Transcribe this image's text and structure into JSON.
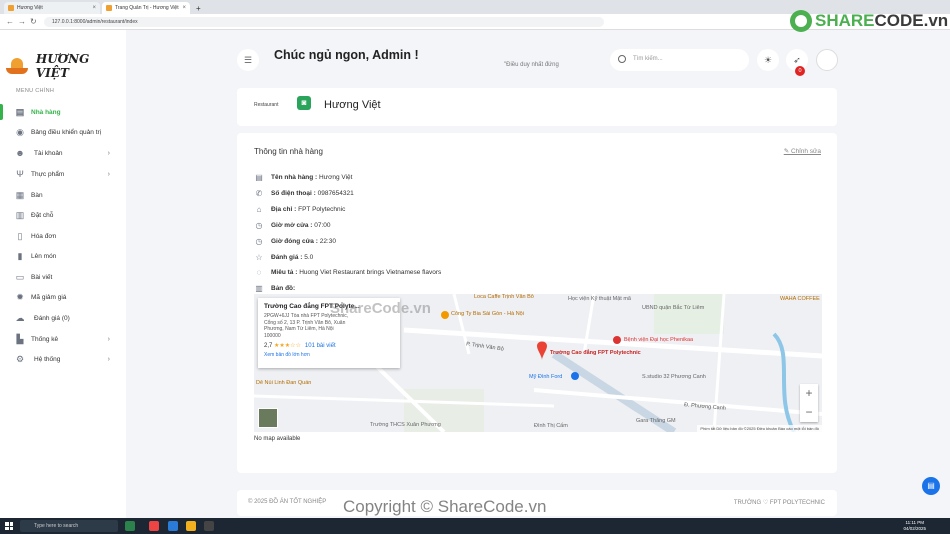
{
  "browser": {
    "tabs": [
      {
        "title": "Hương Việt",
        "active": false
      },
      {
        "title": "Trang Quản Trị - Hương Việt",
        "active": true
      }
    ],
    "new_tab": "+",
    "url": "127.0.0.1:8000/admin/restaurant/index"
  },
  "brand": {
    "name": "HƯƠNG VIỆT",
    "accent": "#35b34a",
    "logo_colors": [
      "#f0a030",
      "#e2711d"
    ]
  },
  "sidebar": {
    "menu_title": "MENU CHÍNH",
    "items": [
      {
        "label": "Nhà hàng",
        "icon": "store-icon",
        "active": true,
        "has_submenu": false
      },
      {
        "label": "Bảng điều khiển quản trị",
        "icon": "dashboard-icon",
        "active": false,
        "has_submenu": false
      },
      {
        "label": "Tài khoản",
        "icon": "users-icon",
        "active": false,
        "has_submenu": true
      },
      {
        "label": "Thực phẩm",
        "icon": "utensils-icon",
        "active": false,
        "has_submenu": true
      },
      {
        "label": "Bàn",
        "icon": "table-icon",
        "active": false,
        "has_submenu": false
      },
      {
        "label": "Đặt chỗ",
        "icon": "calendar-icon",
        "active": false,
        "has_submenu": false
      },
      {
        "label": "Hóa đơn",
        "icon": "invoice-icon",
        "active": false,
        "has_submenu": false
      },
      {
        "label": "Lên món",
        "icon": "clipboard-icon",
        "active": false,
        "has_submenu": false
      },
      {
        "label": "Bài viết",
        "icon": "article-icon",
        "active": false,
        "has_submenu": false
      },
      {
        "label": "Mã giảm giá",
        "icon": "discount-icon",
        "active": false,
        "has_submenu": false
      },
      {
        "label": "Đánh giá (0)",
        "icon": "comments-icon",
        "active": false,
        "has_submenu": false
      },
      {
        "label": "Thống kê",
        "icon": "chart-icon",
        "active": false,
        "has_submenu": true
      },
      {
        "label": "Hệ thống",
        "icon": "settings-icon",
        "active": false,
        "has_submenu": true
      }
    ]
  },
  "header": {
    "greeting": "Chúc ngủ ngon, Admin !",
    "tagline": "\"Điều duy nhất đứng",
    "search_placeholder": "Tìm kiếm...",
    "notification_count": "0"
  },
  "restaurant": {
    "image_alt": "Restaurant",
    "name": "Hương Việt"
  },
  "info": {
    "title": "Thông tin nhà hàng",
    "edit_label": "Chỉnh sửa",
    "rows": [
      {
        "icon": "store-icon",
        "label": "Tên nhà hàng :",
        "value": "Hương Việt"
      },
      {
        "icon": "phone-icon",
        "label": "Số điện thoại :",
        "value": "0987654321"
      },
      {
        "icon": "bank-icon",
        "label": "Địa chỉ :",
        "value": "FPT Polytechnic"
      },
      {
        "icon": "clock-icon",
        "label": "Giờ mở cửa :",
        "value": "07:00"
      },
      {
        "icon": "clock-icon",
        "label": "Giờ đóng cửa :",
        "value": "22:30"
      },
      {
        "icon": "star-icon",
        "label": "Đánh giá :",
        "value": "5.0"
      },
      {
        "icon": "comment-icon",
        "label": "Miêu tả :",
        "value": "Huong Viet Restaurant brings Vietnamese flavors"
      },
      {
        "icon": "map-icon",
        "label": "Bản đồ:",
        "value": ""
      }
    ],
    "no_map": "No map available"
  },
  "map": {
    "popup_title": "Trường Cao đẳng FPT Polyte...",
    "popup_address": [
      "2PGW+6JJ Tòa nhà FPT Polytechnic,",
      "Cổng số 2, 13 P. Trịnh Văn Bô, Xuân",
      "Phương, Nam Từ Liêm, Hà Nội",
      "100000"
    ],
    "popup_rating": "2,7",
    "popup_stars": "★★★☆☆",
    "popup_reviews": "101 bài viết",
    "popup_more": "Xem bản đồ lớn hơn",
    "labels": [
      {
        "text": "Loca Caffe Trịnh Văn Bô",
        "color": "#b36b00"
      },
      {
        "text": "Công Ty Bia Sài Gòn - Hà Nội",
        "color": "#b36b00"
      },
      {
        "text": "Học viện Kỹ thuật Mật mã",
        "color": "#666666"
      },
      {
        "text": "UBND quận Bắc Từ Liêm",
        "color": "#666666"
      },
      {
        "text": "WAHA COFFEE",
        "color": "#b36b00"
      },
      {
        "text": "Bệnh viện Đại học Phenikaa",
        "color": "#d33"
      },
      {
        "text": "Trường Cao đẳng FPT Polytechnic",
        "color": "#c5221f"
      },
      {
        "text": "Mỹ Đình Ford",
        "color": "#1a73e8"
      },
      {
        "text": "S.studio 32 Phương Canh",
        "color": "#666666"
      },
      {
        "text": "Gara Thăng GM",
        "color": "#666666"
      },
      {
        "text": "Đình Thị Cấm",
        "color": "#666666"
      },
      {
        "text": "Trường THCS Xuân Phương",
        "color": "#666666"
      },
      {
        "text": "Dê Núi Linh Đan Quán",
        "color": "#b36b00"
      },
      {
        "text": "P. Trịnh Văn Bô",
        "color": "#555555"
      },
      {
        "text": "Đ. Phương Canh",
        "color": "#555555"
      }
    ],
    "zoom_in": "+",
    "zoom_out": "−",
    "attribution": "Phím tắt   Dữ liệu bản đồ ©2025   Điều khoản   Báo cáo một lỗi bản đồ"
  },
  "footer": {
    "left": "© 2025 ĐỒ ÁN TỐT NGHIỆP",
    "right": "TRƯỜNG ♡ FPT POLYTECHNIC"
  },
  "watermarks": {
    "top_prefix": "SHARE",
    "top_suffix": "CODE.vn",
    "mid": "ShareCode.vn",
    "bottom": "Copyright © ShareCode.vn"
  },
  "taskbar": {
    "search_placeholder": "Type here to search",
    "time": "11:11 PM",
    "date": "04/02/2025"
  }
}
